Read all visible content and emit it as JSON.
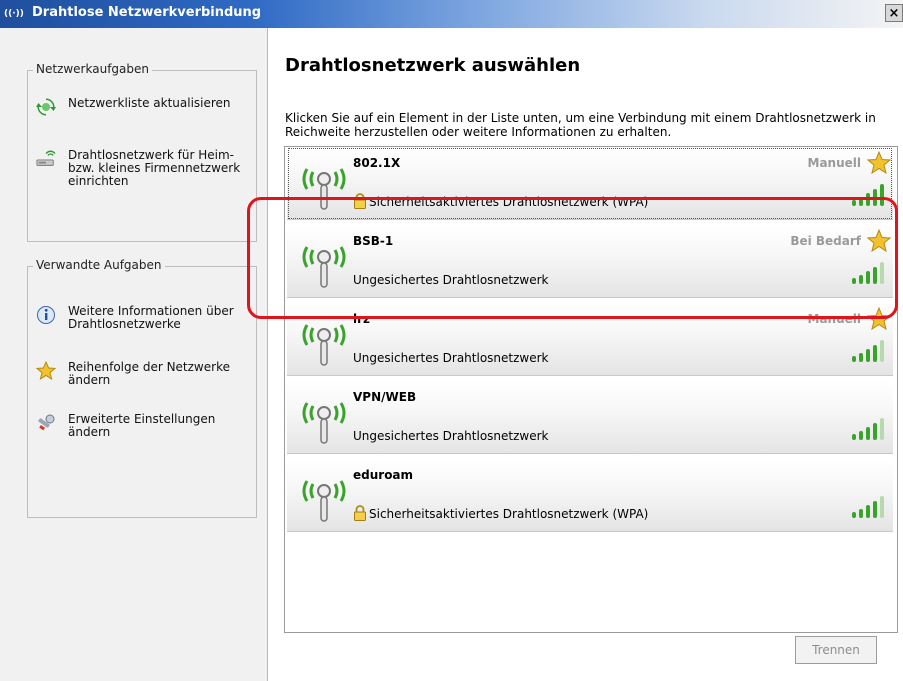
{
  "window": {
    "title": "Drahtlose Netzwerkverbindung",
    "close_label": "×",
    "title_icon": "((·))"
  },
  "sidebar": {
    "tasks_title": "Netzwerkaufgaben",
    "tasks": [
      {
        "icon": "refresh-icon",
        "label": "Netzwerkliste aktualisieren"
      },
      {
        "icon": "wireless-setup-icon",
        "label": "Drahtlosnetzwerk für Heim- bzw. kleines Firmennetzwerk einrichten"
      }
    ],
    "related_title": "Verwandte Aufgaben",
    "related": [
      {
        "icon": "info-icon",
        "label": "Weitere Informationen über Drahtlosnetzwerke"
      },
      {
        "icon": "star-icon",
        "label": "Reihenfolge der Netzwerke ändern"
      },
      {
        "icon": "settings-icon",
        "label": "Erweiterte Einstellungen ändern"
      }
    ]
  },
  "main": {
    "heading": "Drahtlosnetzwerk auswählen",
    "description": "Klicken Sie auf ein Element in der Liste unten, um eine Verbindung mit einem Drahtlosnetzwerk in Reichweite herzustellen oder weitere Informationen zu erhalten.",
    "networks": [
      {
        "name": "802.1X",
        "type": "Manuell",
        "status": "Sicherheitsaktiviertes Drahtlosnetzwerk (WPA)",
        "secure": true,
        "signal_bars": 5
      },
      {
        "name": "BSB-1",
        "type": "Bei Bedarf",
        "status": "Ungesichertes Drahtlosnetzwerk",
        "secure": false,
        "signal_bars": 4
      },
      {
        "name": "lrz",
        "type": "Manuell",
        "status": "Ungesichertes Drahtlosnetzwerk",
        "secure": false,
        "signal_bars": 4
      },
      {
        "name": "VPN/WEB",
        "type": "",
        "status": "Ungesichertes Drahtlosnetzwerk",
        "secure": false,
        "signal_bars": 4
      },
      {
        "name": "eduroam",
        "type": "",
        "status": "Sicherheitsaktiviertes Drahtlosnetzwerk (WPA)",
        "secure": true,
        "signal_bars": 4
      }
    ],
    "disconnect_label": "Trennen"
  },
  "colors": {
    "title_start": "#1f4f9e",
    "highlight": "#e0151b",
    "signal_green": "#3aa32c",
    "signal_dim": "#b7d9b0",
    "star": "#f2c12e"
  }
}
